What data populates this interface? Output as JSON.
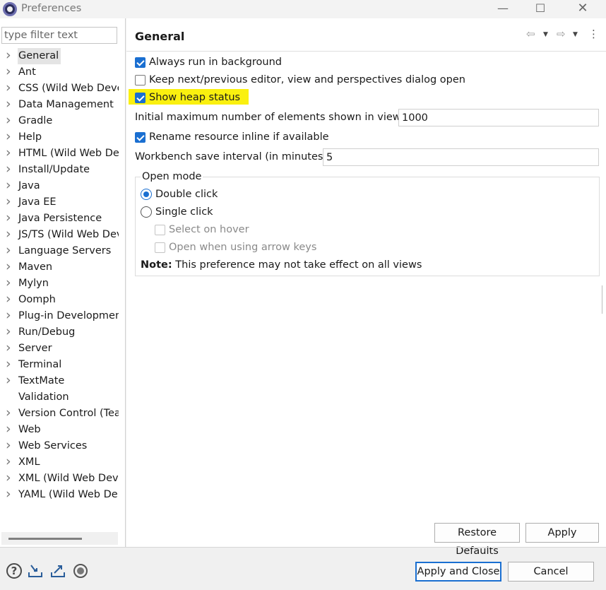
{
  "window": {
    "title": "Preferences",
    "minimize": "—",
    "maximize": "☐",
    "close": "✕"
  },
  "filter": {
    "placeholder": "type filter text"
  },
  "tree": {
    "items": [
      {
        "label": "General",
        "expandable": true,
        "selected": true
      },
      {
        "label": "Ant",
        "expandable": true
      },
      {
        "label": "CSS (Wild Web Deve",
        "expandable": true
      },
      {
        "label": "Data Management",
        "expandable": true
      },
      {
        "label": "Gradle",
        "expandable": true
      },
      {
        "label": "Help",
        "expandable": true
      },
      {
        "label": "HTML (Wild Web De",
        "expandable": true
      },
      {
        "label": "Install/Update",
        "expandable": true
      },
      {
        "label": "Java",
        "expandable": true
      },
      {
        "label": "Java EE",
        "expandable": true
      },
      {
        "label": "Java Persistence",
        "expandable": true
      },
      {
        "label": "JS/TS (Wild Web Dev",
        "expandable": true
      },
      {
        "label": "Language Servers",
        "expandable": true
      },
      {
        "label": "Maven",
        "expandable": true
      },
      {
        "label": "Mylyn",
        "expandable": true
      },
      {
        "label": "Oomph",
        "expandable": true
      },
      {
        "label": "Plug-in Developmen",
        "expandable": true
      },
      {
        "label": "Run/Debug",
        "expandable": true
      },
      {
        "label": "Server",
        "expandable": true
      },
      {
        "label": "Terminal",
        "expandable": true
      },
      {
        "label": "TextMate",
        "expandable": true
      },
      {
        "label": "Validation",
        "expandable": false
      },
      {
        "label": "Version Control (Tea",
        "expandable": true
      },
      {
        "label": "Web",
        "expandable": true
      },
      {
        "label": "Web Services",
        "expandable": true
      },
      {
        "label": "XML",
        "expandable": true
      },
      {
        "label": "XML (Wild Web Deve",
        "expandable": true
      },
      {
        "label": "YAML (Wild Web De",
        "expandable": true
      }
    ]
  },
  "page": {
    "title": "General",
    "options": {
      "always_run_background": {
        "label": "Always run in background",
        "checked": true
      },
      "keep_next_prev": {
        "label": "Keep next/previous editor, view and perspectives dialog open",
        "checked": false
      },
      "show_heap_status": {
        "label": "Show heap status",
        "checked": true,
        "highlight_color": "#faf00f"
      },
      "rename_inline": {
        "label": "Rename resource inline if available",
        "checked": true
      }
    },
    "max_elements": {
      "label": "Initial maximum number of elements shown in views:",
      "value": "1000"
    },
    "save_interval": {
      "label": "Workbench save interval (in minutes):",
      "value": "5"
    },
    "open_mode": {
      "title": "Open mode",
      "double_click": {
        "label": "Double click",
        "selected": true
      },
      "single_click": {
        "label": "Single click",
        "selected": false
      },
      "select_on_hover": {
        "label": "Select on hover",
        "checked": false,
        "enabled": false
      },
      "open_arrow_keys": {
        "label": "Open when using arrow keys",
        "checked": false,
        "enabled": false
      },
      "note_bold": "Note:",
      "note_text": " This preference may not take effect on all views"
    }
  },
  "buttons": {
    "restore_defaults": "Restore Defaults",
    "apply": "Apply",
    "apply_and_close": "Apply and Close",
    "cancel": "Cancel"
  },
  "colors": {
    "accent": "#1a6fd1",
    "highlight": "#faf00f"
  },
  "icons": {
    "nav_back": "back-arrow-icon",
    "nav_forward": "forward-arrow-icon",
    "view_menu": "view-menu-icon",
    "help": "help-icon",
    "import": "import-icon",
    "export": "export-icon",
    "record": "record-icon"
  }
}
